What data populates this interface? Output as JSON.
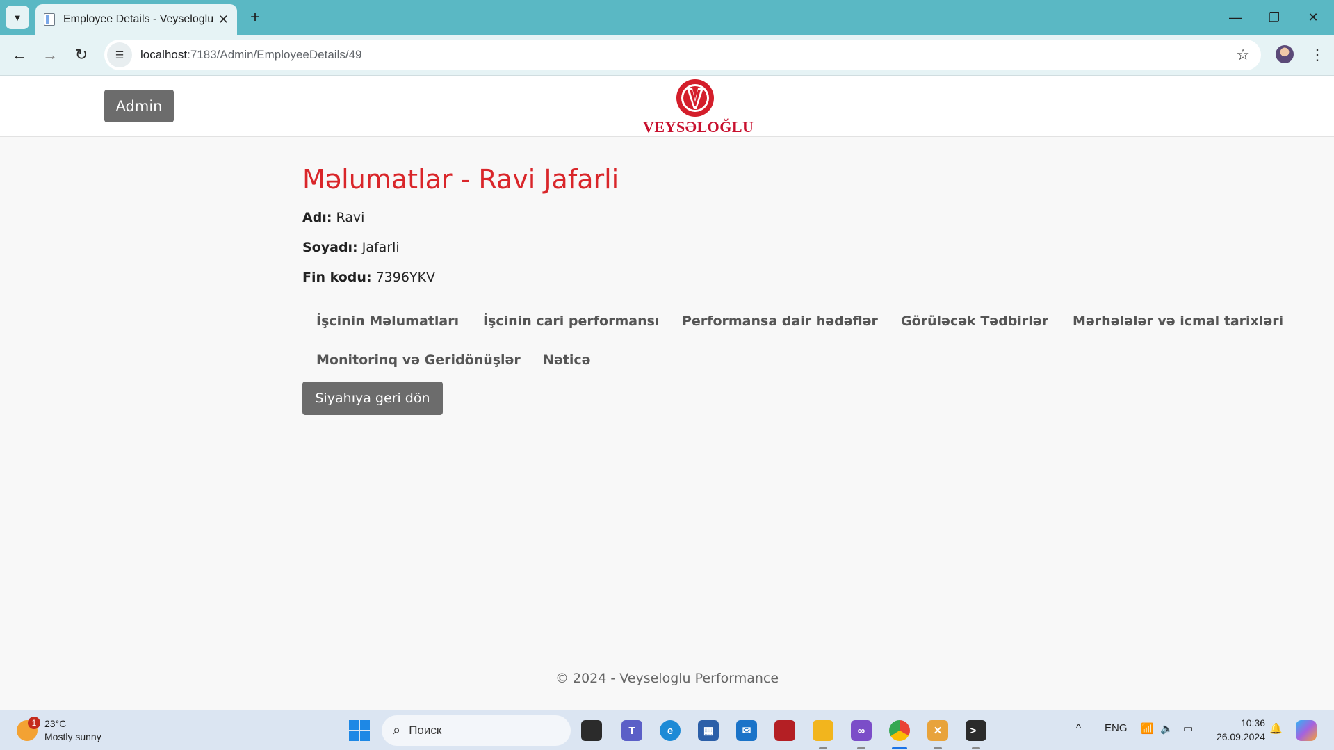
{
  "browser": {
    "tab_title": "Employee Details - Veyseloglu P",
    "url_host": "localhost",
    "url_rest": ":7183/Admin/EmployeeDetails/49"
  },
  "header": {
    "admin_label": "Admin",
    "logo_text": "VEYSƏLOĞLU"
  },
  "page": {
    "title": "Məlumatlar - Ravi Jafarli",
    "fields": [
      {
        "label": "Adı:",
        "value": "Ravi"
      },
      {
        "label": "Soyadı:",
        "value": "Jafarli"
      },
      {
        "label": "Fin kodu:",
        "value": "7396YKV"
      }
    ],
    "tabs": [
      "İşcinin Məlumatları",
      "İşcinin cari performansı",
      "Performansa dair hədəflər",
      "Görüləcək Tədbirlər",
      "Mərhələlər və icmal tarixləri",
      "Monitorinq və Geridönüşlər",
      "Nəticə"
    ],
    "back_label": "Siyahıya geri dön"
  },
  "footer": {
    "text": "© 2024 - Veyseloglu Performance"
  },
  "taskbar": {
    "temperature": "23°C",
    "weather": "Mostly sunny",
    "weather_badge": "1",
    "search_placeholder": "Поиск",
    "language": "ENG",
    "time": "10:36",
    "date": "26.09.2024"
  }
}
